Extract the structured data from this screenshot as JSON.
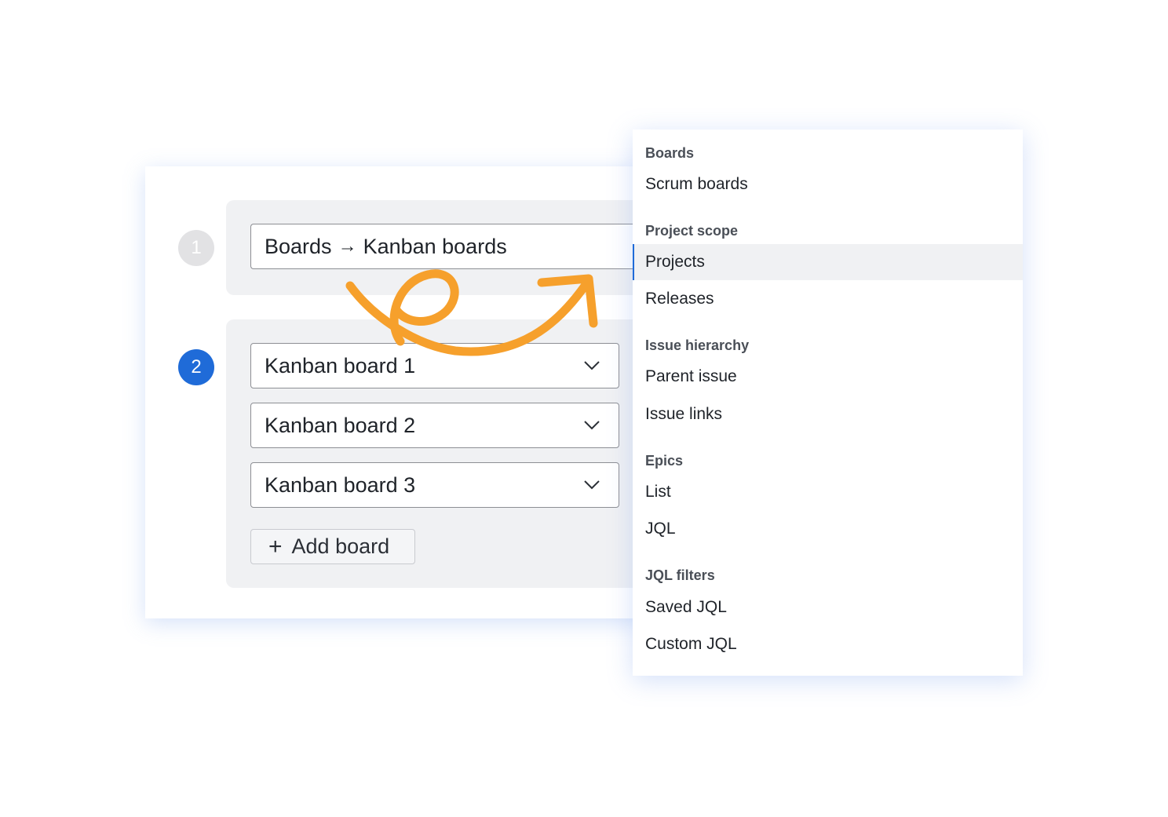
{
  "steps": [
    {
      "number": "1",
      "color": "#e2e2e4"
    },
    {
      "number": "2",
      "color": "#1f6bd8"
    }
  ],
  "path_field": {
    "first": "Boards",
    "arrow": "→",
    "second": "Kanban boards"
  },
  "boards": [
    {
      "label": "Kanban board 1",
      "icon": "chevron-down-icon"
    },
    {
      "label": "Kanban board 2",
      "icon": "chevron-down-icon"
    },
    {
      "label": "Kanban board 3",
      "icon": "chevron-down-icon"
    }
  ],
  "add_button": {
    "icon": "+",
    "label": "Add board"
  },
  "menu": {
    "groups": [
      {
        "title": "Boards",
        "items": [
          "Scrum boards"
        ]
      },
      {
        "title": "Project scope",
        "items": [
          "Projects",
          "Releases"
        ]
      },
      {
        "title": "Issue hierarchy",
        "items": [
          "Parent issue",
          "Issue links"
        ]
      },
      {
        "title": "Epics",
        "items": [
          "List",
          "JQL"
        ]
      },
      {
        "title": "JQL filters",
        "items": [
          "Saved JQL",
          "Custom JQL"
        ]
      }
    ],
    "selected": "Projects"
  },
  "colors": {
    "accent": "#1f6bd8",
    "doodle": "#f6a02c",
    "panel": "#f0f1f3"
  }
}
